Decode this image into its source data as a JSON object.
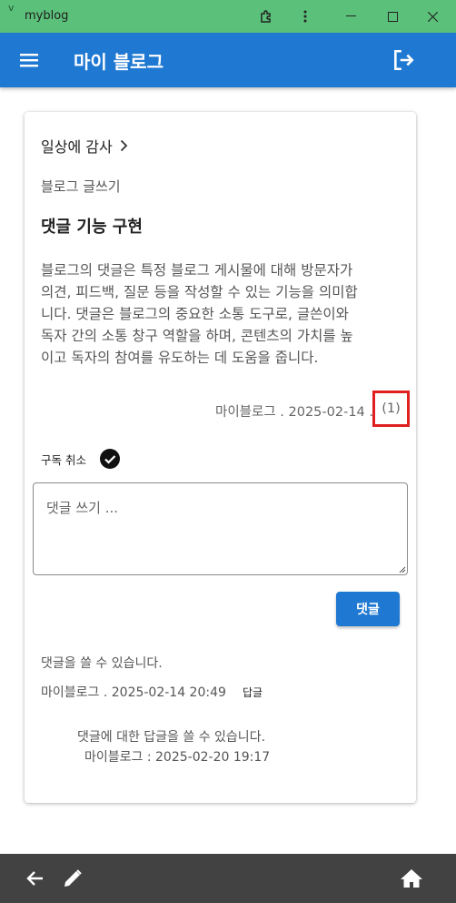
{
  "window": {
    "title": "myblog"
  },
  "appbar": {
    "title": "마이 블로그"
  },
  "post": {
    "category": "일상에 감사",
    "board": "블로그 글쓰기",
    "title": "댓글 기능 구현",
    "body_lines": [
      "블로그의 댓글은 특정 블로그 게시물에 대해 방문자가",
      "의견, 피드백, 질문 등을 작성할 수 있는 기능을 의미합",
      "니다. 댓글은 블로그의 중요한 소통 도구로, 글쓴이와",
      "독자 간의 소통 창구 역할을 하며, 콘텐츠의 가치를 높",
      "이고 독자의 참여를 유도하는 데 도움을 줍니다."
    ],
    "meta": "마이블로그 . 2025-02-14 .",
    "comment_count": "(1)"
  },
  "subscribe": {
    "label": "구독 취소",
    "checked": true
  },
  "comment_form": {
    "placeholder": "댓글 쓰기 ...",
    "submit_label": "댓글"
  },
  "comments": [
    {
      "text": "댓글을 쓸 수 있습니다.",
      "meta": "마이블로그 . 2025-02-14 20:49",
      "reply_label": "답글",
      "replies": [
        {
          "text": "댓글에 대한 답글을 쓸 수 있습니다.",
          "meta": "마이블로그 : 2025-02-20 19:17"
        }
      ]
    }
  ],
  "colors": {
    "titlebar": "#5bc07a",
    "primary": "#1f78d1",
    "bottombar": "#424242",
    "highlight": "#e02020"
  },
  "icons": {
    "menu": "menu-icon",
    "logout": "logout-icon",
    "back": "arrow-back-icon",
    "edit": "pencil-icon",
    "home": "home-icon"
  }
}
